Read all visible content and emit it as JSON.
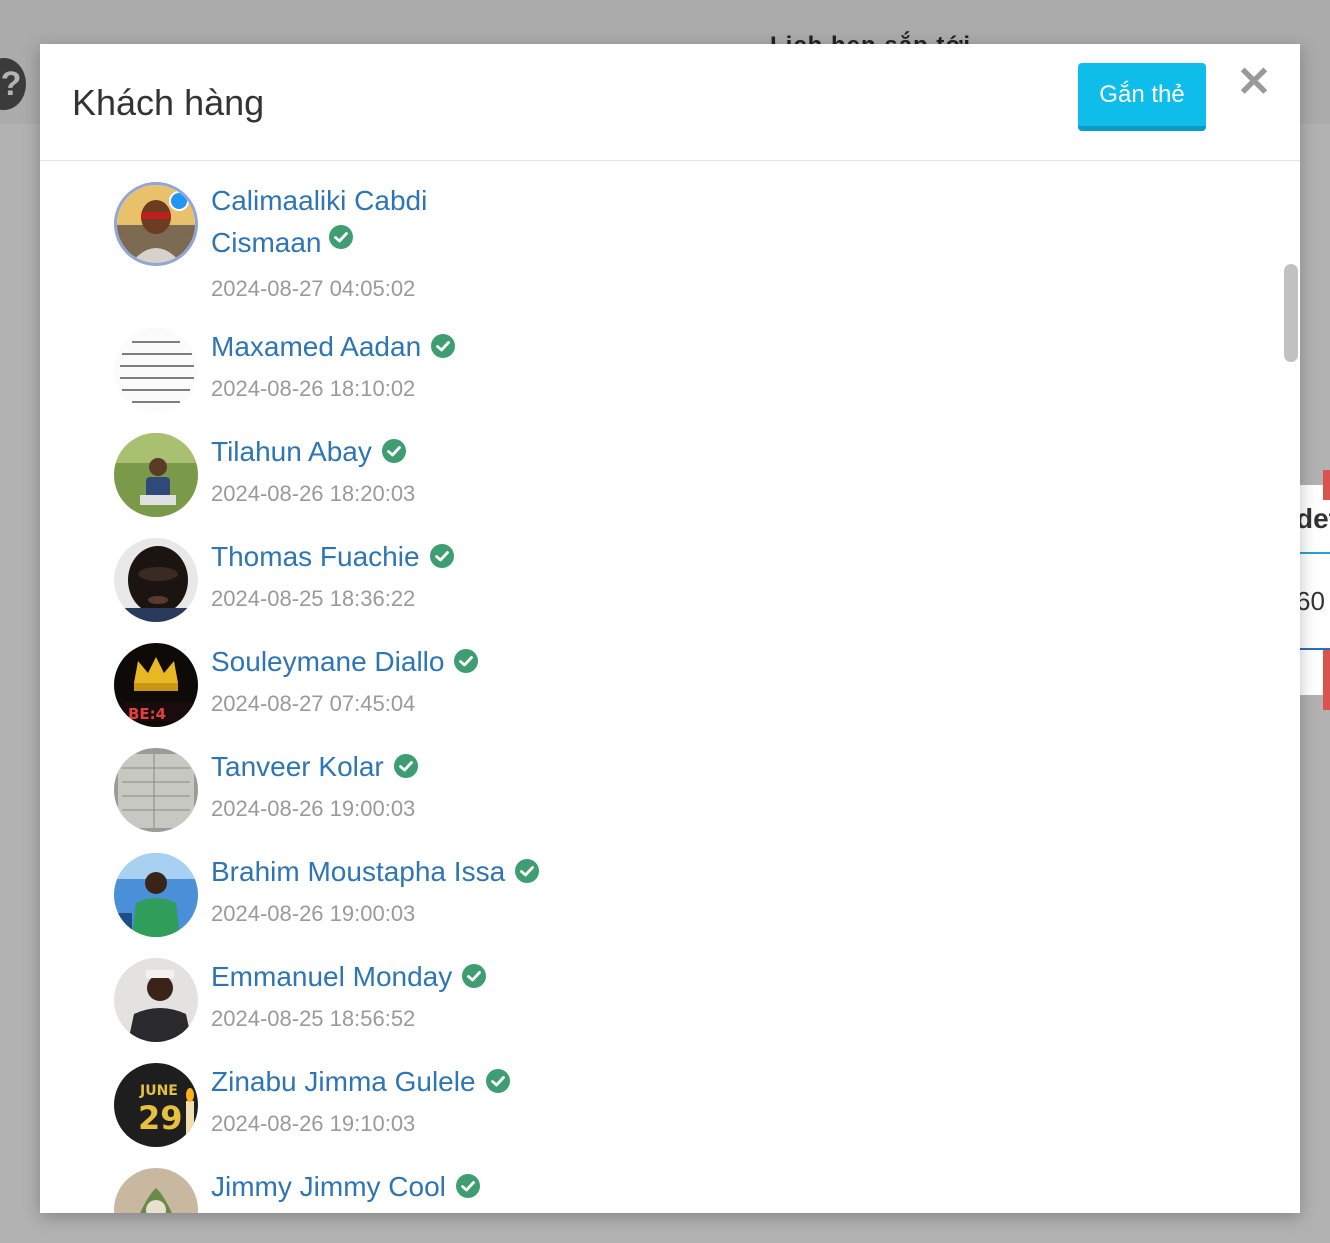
{
  "background": {
    "heading": "Lịch hẹn sắp tới"
  },
  "modal": {
    "title": "Khách hàng",
    "tag_button": "Gắn thẻ",
    "close": "✕"
  },
  "customers": [
    {
      "name": "Calimaaliki Cabdi Cismaan",
      "time": "2024-08-27 04:05:02",
      "avatar_icon": "photo-man-sunglasses"
    },
    {
      "name": "Maxamed Aadan",
      "time": "2024-08-26 18:10:02",
      "avatar_icon": "arabic-text-image"
    },
    {
      "name": "Tilahun Abay",
      "time": "2024-08-26 18:20:03",
      "avatar_icon": "photo-man-outdoors"
    },
    {
      "name": "Thomas Fuachie",
      "time": "2024-08-25 18:36:22",
      "avatar_icon": "photo-man-closeup"
    },
    {
      "name": "Souleymane Diallo",
      "time": "2024-08-27 07:45:04",
      "avatar_icon": "crown-image"
    },
    {
      "name": "Tanveer Kolar",
      "time": "2024-08-26 19:00:03",
      "avatar_icon": "document-photo"
    },
    {
      "name": "Brahim Moustapha Issa",
      "time": "2024-08-26 19:00:03",
      "avatar_icon": "photo-man-car"
    },
    {
      "name": "Emmanuel Monday",
      "time": "2024-08-25 18:56:52",
      "avatar_icon": "photo-man-indoor"
    },
    {
      "name": "Zinabu Jimma Gulele",
      "time": "2024-08-26 19:10:03",
      "avatar_icon": "june-29-candle"
    },
    {
      "name": "Jimmy Jimmy Cool",
      "time": "",
      "avatar_icon": "photo-plants"
    }
  ],
  "colors": {
    "link": "#2d75b4",
    "verified": "#3e9d71",
    "button": "#0fbdea",
    "overlay": "#b2b2b2"
  }
}
